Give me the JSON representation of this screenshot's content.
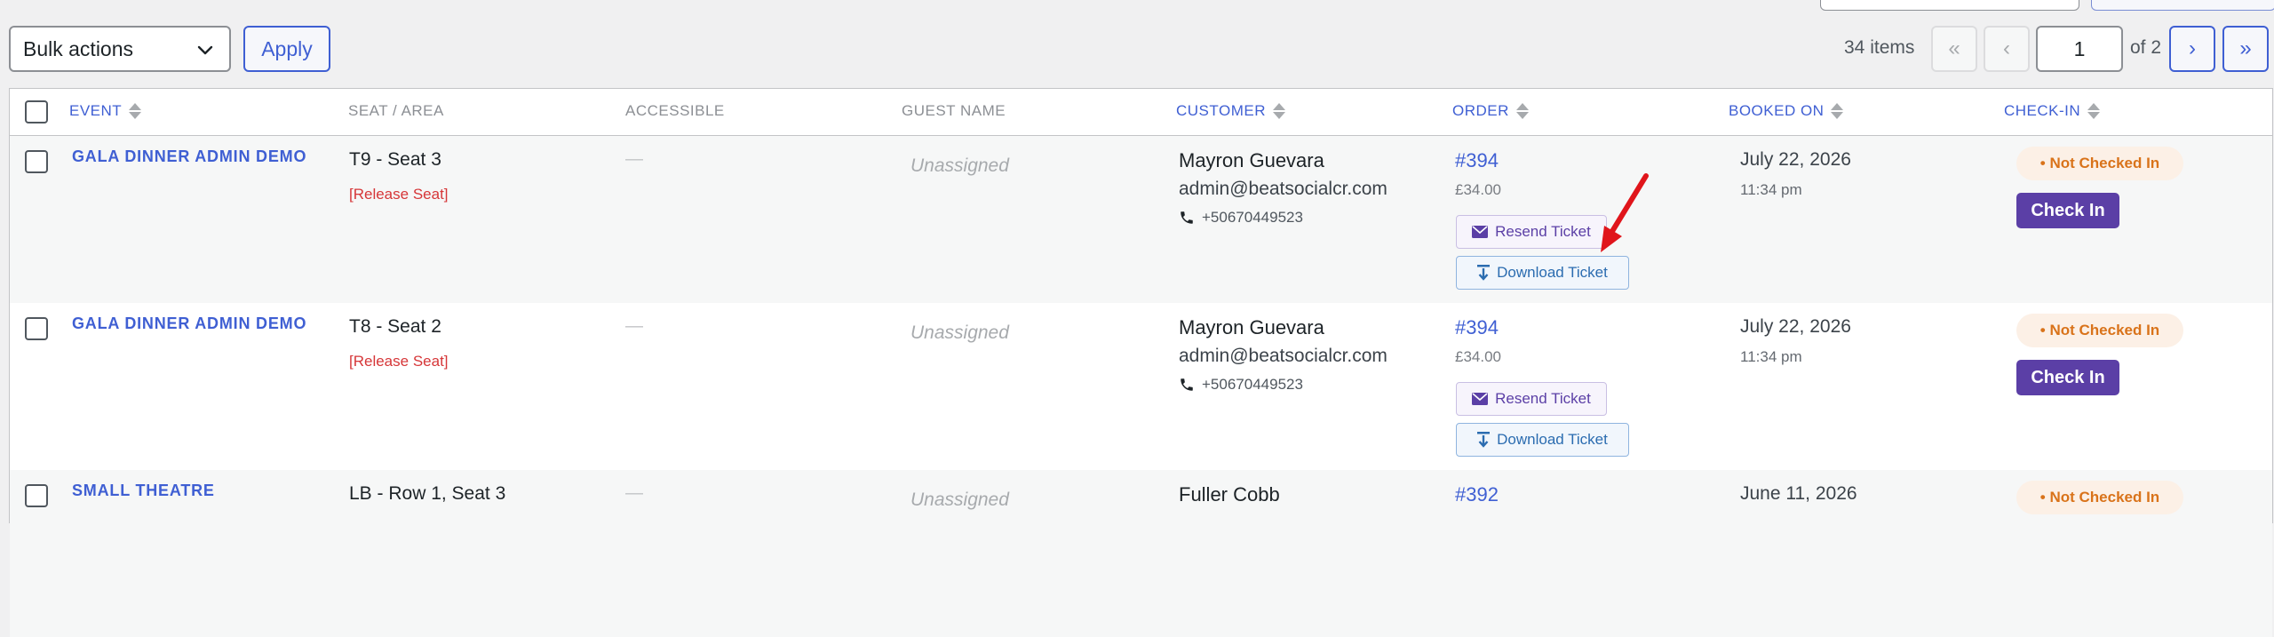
{
  "colors": {
    "accent": "#3f5fd3",
    "purple": "#5b3fa6",
    "release_red": "#d63638",
    "status_orange": "#d9731a",
    "annotation_arrow": "#e0151b"
  },
  "bulk": {
    "select_value": "Bulk actions",
    "apply_label": "Apply"
  },
  "pagination": {
    "items_count": "34 items",
    "first": "«",
    "prev": "‹",
    "current_page": "1",
    "of_total": "of 2",
    "next": "›",
    "last": "»"
  },
  "table": {
    "columns": {
      "event": "EVENT",
      "seat": "SEAT / AREA",
      "accessible": "ACCESSIBLE",
      "guest": "GUEST NAME",
      "customer": "CUSTOMER",
      "order": "ORDER",
      "booked": "BOOKED ON",
      "checkin": "CHECK-IN"
    },
    "rows": [
      {
        "event": "GALA DINNER ADMIN DEMO",
        "seat": "T9 - Seat 3",
        "release": "[Release Seat]",
        "accessible": "—",
        "guest": "Unassigned",
        "customer_name": "Mayron Guevara",
        "customer_email": "admin@beatsocialcr.com",
        "customer_phone": "+50670449523",
        "order_number": "#394",
        "order_amount": "£34.00",
        "resend_label": "Resend Ticket",
        "download_label": "Download Ticket",
        "booked_date": "July 22, 2026",
        "booked_time": "11:34 pm",
        "status": "• Not Checked In",
        "checkin_label": "Check In"
      },
      {
        "event": "GALA DINNER ADMIN DEMO",
        "seat": "T8 - Seat 2",
        "release": "[Release Seat]",
        "accessible": "—",
        "guest": "Unassigned",
        "customer_name": "Mayron Guevara",
        "customer_email": "admin@beatsocialcr.com",
        "customer_phone": "+50670449523",
        "order_number": "#394",
        "order_amount": "£34.00",
        "resend_label": "Resend Ticket",
        "download_label": "Download Ticket",
        "booked_date": "July 22, 2026",
        "booked_time": "11:34 pm",
        "status": "• Not Checked In",
        "checkin_label": "Check In"
      },
      {
        "event": "SMALL THEATRE",
        "seat": "LB - Row 1, Seat 3",
        "accessible": "—",
        "guest": "Unassigned",
        "customer_name": "Fuller Cobb",
        "order_number": "#392",
        "booked_date": "June 11, 2026",
        "status": "• Not Checked In"
      }
    ]
  }
}
